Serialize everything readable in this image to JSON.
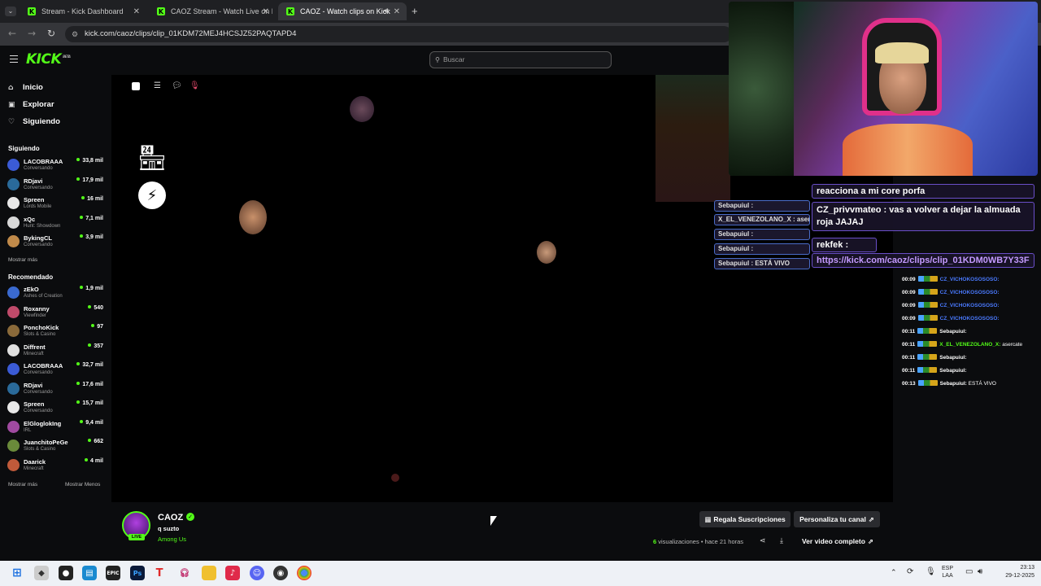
{
  "browser": {
    "tabs": [
      {
        "label": "Stream - Kick Dashboard",
        "active": false
      },
      {
        "label": "CAOZ Stream - Watch Live on K",
        "active": false
      },
      {
        "label": "CAOZ - Watch clips on Kick",
        "active": true
      }
    ],
    "new_tab": "+",
    "url": "kick.com/caoz/clips/clip_01KDM72MEJ4HCSJZ52PAQTAPD4"
  },
  "header": {
    "logo": "KICK",
    "logo_sup": "BETA",
    "search_placeholder": "Buscar"
  },
  "sidebar": {
    "nav": [
      {
        "label": "Inicio",
        "icon": "home-icon"
      },
      {
        "label": "Explorar",
        "icon": "compass-icon"
      },
      {
        "label": "Siguiendo",
        "icon": "heart-icon"
      }
    ],
    "following_title": "Siguiendo",
    "following": [
      {
        "name": "LACOBRAAA",
        "category": "Conversando",
        "viewers": "33,8 mil",
        "color": "#3b5bd6"
      },
      {
        "name": "RDjavi",
        "category": "Conversando",
        "viewers": "17,9 mil",
        "color": "#2a6a9a"
      },
      {
        "name": "Spreen",
        "category": "Lords Mobile",
        "viewers": "16 mil",
        "color": "#e8e8e8"
      },
      {
        "name": "xQc",
        "category": "Hunt: Showdown",
        "viewers": "7,1 mil",
        "color": "#d8d8d8"
      },
      {
        "name": "BykingCL",
        "category": "Conversando",
        "viewers": "3,9 mil",
        "color": "#c08a4a"
      }
    ],
    "show_more": "Mostrar más",
    "recommended_title": "Recomendado",
    "recommended": [
      {
        "name": "zEkO",
        "category": "Ashes of Creation",
        "viewers": "1,9 mil",
        "color": "#3a6ad0"
      },
      {
        "name": "Roxanny",
        "category": "Viewfinder",
        "viewers": "540",
        "color": "#c04a6a"
      },
      {
        "name": "PonchoKick",
        "category": "Slots & Casino",
        "viewers": "97",
        "color": "#8a6a3a"
      },
      {
        "name": "Diffrent",
        "category": "Minecraft",
        "viewers": "357",
        "color": "#e0e0e0"
      },
      {
        "name": "LACOBRAAA",
        "category": "Conversando",
        "viewers": "32,7 mil",
        "color": "#3b5bd6"
      },
      {
        "name": "RDjavi",
        "category": "Conversando",
        "viewers": "17,6 mil",
        "color": "#2a6a9a"
      },
      {
        "name": "Spreen",
        "category": "Conversando",
        "viewers": "15,7 mil",
        "color": "#e8e8e8"
      },
      {
        "name": "ElGloglokIng",
        "category": "IRL",
        "viewers": "9,4 mil",
        "color": "#a04aa0"
      },
      {
        "name": "JuanchitoPeGe",
        "category": "Slots & Casino",
        "viewers": "662",
        "color": "#6a8a3a"
      },
      {
        "name": "Daarick",
        "category": "Minecraft",
        "viewers": "4 mil",
        "color": "#c05a3a"
      }
    ],
    "show_more_2": "Mostrar más",
    "show_less": "Mostrar Menos"
  },
  "overlay_chat": {
    "big": [
      {
        "text": "reacciona a mi core porfa"
      },
      {
        "text": "CZ_privvmateo : vas a volver a dejar la almuada roja JAJAJ"
      },
      {
        "text": "rekfek :"
      },
      {
        "text": "https://kick.com/caoz/clips/clip_01KDM0WB7Y33F"
      }
    ],
    "mid": [
      {
        "text": "Sebapuiul :"
      },
      {
        "text": "X_EL_VENEZOLANO_X : asercate"
      },
      {
        "text": "Sebapuiul :"
      },
      {
        "text": "Sebapuiul :"
      },
      {
        "text": "Sebapuiul : ESTÁ VIVO"
      }
    ]
  },
  "chat_column": [
    {
      "time": "00:09",
      "user": "CZ_VICHOKOSOSOSO:",
      "msg": "",
      "color": "#4a7aff"
    },
    {
      "time": "00:09",
      "user": "CZ_VICHOKOSOSOSO:",
      "msg": "",
      "color": "#4a7aff"
    },
    {
      "time": "00:09",
      "user": "CZ_VICHOKOSOSOSO:",
      "msg": "",
      "color": "#4a7aff"
    },
    {
      "time": "00:09",
      "user": "CZ_VICHOKOSOSOSO:",
      "msg": "",
      "color": "#4a7aff"
    },
    {
      "time": "00:11",
      "user": "Sebapuiul:",
      "msg": "",
      "color": "#ffffff"
    },
    {
      "time": "00:11",
      "user": "X_EL_VENEZOLANO_X:",
      "msg": "asercate",
      "color": "#53fc18"
    },
    {
      "time": "00:11",
      "user": "Sebapuiul:",
      "msg": "",
      "color": "#ffffff"
    },
    {
      "time": "00:11",
      "user": "Sebapuiul:",
      "msg": "",
      "color": "#ffffff"
    },
    {
      "time": "00:13",
      "user": "Sebapuiul:",
      "msg": "ESTÁ VIVO",
      "color": "#ffffff"
    }
  ],
  "channel": {
    "name": "CAOZ",
    "title": "q suzto",
    "category": "Among Us",
    "live_badge": "LIVE",
    "gift_button": "Regala Suscripciones",
    "customize_button": "Personaliza tu canal",
    "views_count": "6",
    "views_label": "visualizaciones",
    "time_ago": "• hace 21 horas",
    "full_video_button": "Ver video completo"
  },
  "taskbar": {
    "lang_top": "ESP",
    "lang_bottom": "LAA",
    "time": "23:13",
    "date": "29-12-2025"
  },
  "colors": {
    "kick_green": "#53fc18",
    "bg": "#0b0c0e",
    "chrome_dark": "#1f2023"
  }
}
